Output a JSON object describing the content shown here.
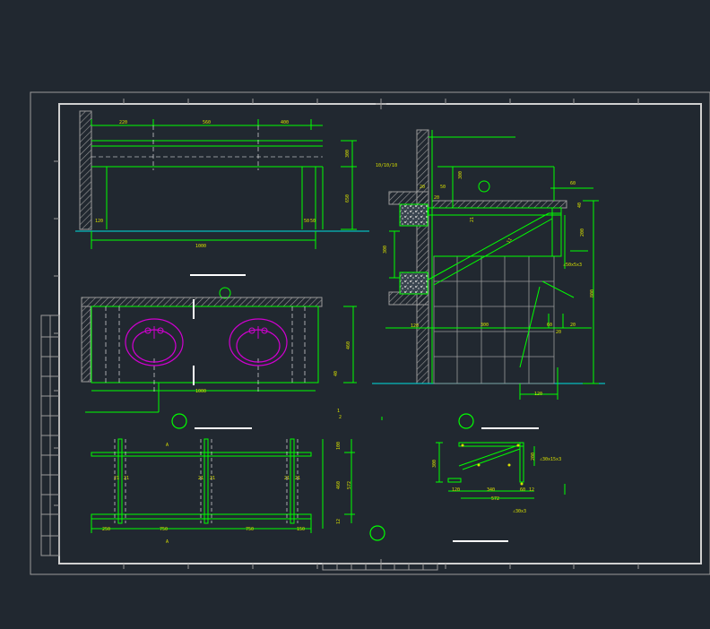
{
  "colors": {
    "background": "#212830",
    "frame": "#c8c8c8",
    "green": "#00ff00",
    "cyan": "#00e0e0",
    "yellow": "#d8e000",
    "magenta": "#d000d0",
    "white": "#ffffff",
    "gray": "#a0a0a0",
    "hatch": "#9a9a9a"
  },
  "icons": [
    "section-marker-icon",
    "basin-icon",
    "faucet-icon",
    "hatch-wall-icon"
  ],
  "elevation_top": {
    "dims_top": [
      "220",
      "560",
      "400"
    ],
    "dims_right": [
      "300",
      "650"
    ],
    "dims_bottom": [
      "120",
      "50",
      "50"
    ],
    "total": "1000"
  },
  "basin_plan": {
    "width": "1000",
    "depth": "460",
    "side": "40"
  },
  "rail_elevation": {
    "dims_bottom": [
      "250",
      "750",
      "750",
      "150"
    ],
    "dims_right": [
      "100",
      "460",
      "572",
      "12"
    ],
    "labels_left": [
      "21",
      "21",
      "21"
    ],
    "labels_right": [
      "21",
      "21",
      "21"
    ],
    "section_mark": "A"
  },
  "section_right": {
    "left_labels": [
      "10/10/10",
      "120",
      "300"
    ],
    "top_labels": [
      "20",
      "300",
      "20",
      "50"
    ],
    "right_labels": [
      "40",
      "200",
      "800",
      "∠50x5x3",
      "60"
    ],
    "inner_labels": [
      "21",
      "11"
    ],
    "bottom_labels": [
      "120",
      "300",
      "60",
      "20",
      "20",
      "120"
    ]
  },
  "detail_small": {
    "left": "300",
    "right": "200",
    "spec_right": "∠30x15x3",
    "bottom": [
      "120",
      "340",
      "60",
      "12"
    ],
    "total": "572",
    "spec_bottom": "∠30x3"
  },
  "misc": [
    "1",
    "2"
  ]
}
